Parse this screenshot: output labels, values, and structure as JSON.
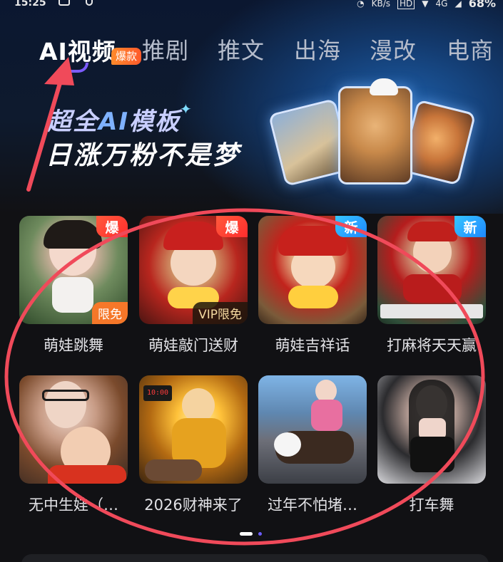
{
  "status_bar": {
    "time": "15:25",
    "network_speed": "KB/s",
    "sim": "HD",
    "network": "4G",
    "battery": "68%"
  },
  "tabs": [
    {
      "label": "AI视频",
      "active": true,
      "badge": "爆款"
    },
    {
      "label": "推剧",
      "active": false
    },
    {
      "label": "推文",
      "active": false
    },
    {
      "label": "出海",
      "active": false
    },
    {
      "label": "漫改",
      "active": false
    },
    {
      "label": "电商",
      "active": false
    }
  ],
  "banner": {
    "line1_ai": "AI",
    "line1_prefix": "超全",
    "line1_suffix": "模板",
    "line2": "日涨万粉不是梦"
  },
  "templates": [
    {
      "label": "萌娃跳舞",
      "badge": "爆",
      "badge_type": "hot",
      "corner": "限免",
      "corner_type": "free"
    },
    {
      "label": "萌娃敲门送财",
      "badge": "爆",
      "badge_type": "hot",
      "corner": "VIP限免",
      "corner_type": "vip"
    },
    {
      "label": "萌娃吉祥话",
      "badge": "新",
      "badge_type": "new"
    },
    {
      "label": "打麻将天天赢",
      "badge": "新",
      "badge_type": "new"
    },
    {
      "label": "无中生娃（…"
    },
    {
      "label": "2026财神来了"
    },
    {
      "label": "过年不怕堵…"
    },
    {
      "label": "打车舞"
    }
  ],
  "pager": {
    "pages": 2,
    "current": 1
  },
  "colors": {
    "accent": "#7c5cff",
    "hot_badge": "#ff2d2d",
    "new_badge": "#1e88ff",
    "annotation": "#f04a5a"
  }
}
